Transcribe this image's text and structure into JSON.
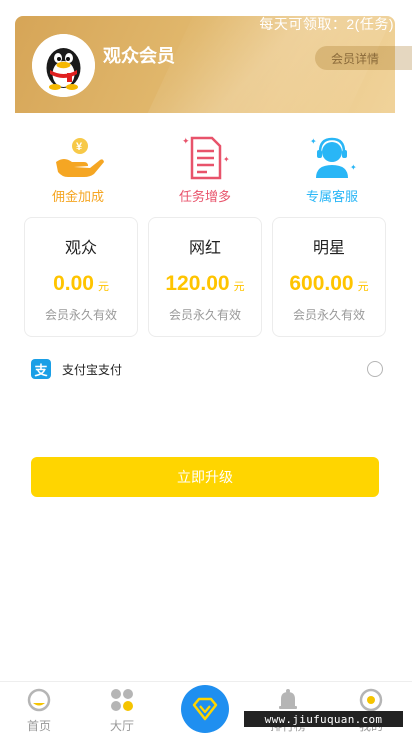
{
  "header": {
    "daily_text": "每天可领取：2(任务)",
    "title": "观众会员",
    "detail_button": "会员详情"
  },
  "features": [
    {
      "label": "佣金加成",
      "icon": "hand-coin-icon",
      "color": "#f5a623"
    },
    {
      "label": "任务增多",
      "icon": "task-document-icon",
      "color": "#e8536b"
    },
    {
      "label": "专属客服",
      "icon": "customer-service-icon",
      "color": "#29b6f6"
    }
  ],
  "plans": [
    {
      "name": "观众",
      "price": "0.00",
      "unit": "元",
      "note": "会员永久有效"
    },
    {
      "name": "网红",
      "price": "120.00",
      "unit": "元",
      "note": "会员永久有效"
    },
    {
      "name": "明星",
      "price": "600.00",
      "unit": "元",
      "note": "会员永久有效"
    }
  ],
  "payment": {
    "icon_glyph": "支",
    "label": "支付宝支付",
    "selected": false
  },
  "upgrade_button": "立即升级",
  "nav": [
    {
      "label": "首页",
      "icon": "home-icon"
    },
    {
      "label": "大厅",
      "icon": "hall-icon"
    },
    {
      "label": "",
      "icon": "vip-diamond-icon"
    },
    {
      "label": "排行榜",
      "icon": "bell-icon"
    },
    {
      "label": "我的",
      "icon": "profile-icon"
    }
  ],
  "watermark": "www.jiufuquan.com",
  "colors": {
    "accent_yellow": "#ffd500",
    "price_yellow": "#ffc400",
    "nav_blue": "#1f8ff0",
    "alipay_blue": "#1a9fe6"
  }
}
